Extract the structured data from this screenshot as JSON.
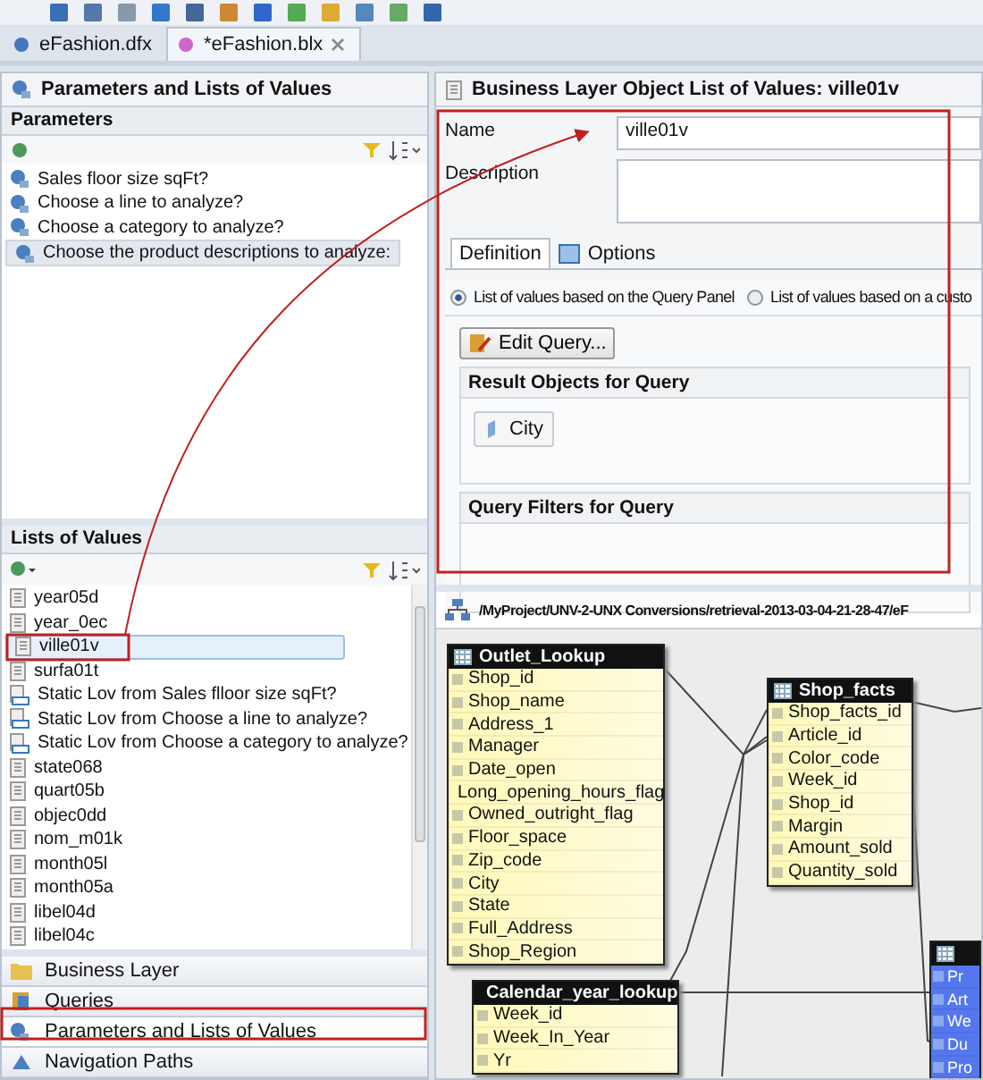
{
  "editor_tabs": [
    {
      "label": "eFashion.dfx",
      "selected": false
    },
    {
      "label": "*eFashion.blx",
      "selected": true
    }
  ],
  "left_panel": {
    "title": "Parameters and Lists of Values",
    "parameters": {
      "title": "Parameters",
      "items": [
        {
          "label": "Sales floor size sqFt?",
          "selected": false
        },
        {
          "label": "Choose a line to analyze?",
          "selected": false
        },
        {
          "label": "Choose a category to analyze?",
          "selected": false
        },
        {
          "label": "Choose the product descriptions to analyze:",
          "selected": true
        }
      ]
    },
    "lists_of_values": {
      "title": "Lists of Values",
      "items": [
        {
          "label": "year05d",
          "kind": "lov",
          "selected": false
        },
        {
          "label": "year_0ec",
          "kind": "lov",
          "selected": false
        },
        {
          "label": "ville01v",
          "kind": "lov",
          "selected": true
        },
        {
          "label": "surfa01t",
          "kind": "lov",
          "selected": false
        },
        {
          "label": "Static Lov from Sales flloor size sqFt?",
          "kind": "static",
          "selected": false
        },
        {
          "label": "Static Lov from Choose a line to analyze?",
          "kind": "static",
          "selected": false
        },
        {
          "label": "Static Lov from Choose a category to analyze?",
          "kind": "static",
          "selected": false
        },
        {
          "label": "state068",
          "kind": "lov",
          "selected": false
        },
        {
          "label": "quart05b",
          "kind": "lov",
          "selected": false
        },
        {
          "label": "objec0dd",
          "kind": "lov",
          "selected": false
        },
        {
          "label": "nom_m01k",
          "kind": "lov",
          "selected": false
        },
        {
          "label": "month05l",
          "kind": "lov",
          "selected": false
        },
        {
          "label": "month05a",
          "kind": "lov",
          "selected": false
        },
        {
          "label": "libel04d",
          "kind": "lov",
          "selected": false
        },
        {
          "label": "libel04c",
          "kind": "lov",
          "selected": false
        }
      ]
    }
  },
  "nav": [
    {
      "label": "Business Layer",
      "kind": "folder",
      "selected": false
    },
    {
      "label": "Queries",
      "kind": "queries",
      "selected": false
    },
    {
      "label": "Parameters and Lists of Values",
      "kind": "params",
      "selected": true
    },
    {
      "label": "Navigation Paths",
      "kind": "paths",
      "selected": false
    }
  ],
  "editor": {
    "title": "Business Layer Object List of Values: ville01v",
    "name_label": "Name",
    "name_value": "ville01v",
    "description_label": "Description",
    "tabs": [
      {
        "label": "Definition",
        "selected": true
      },
      {
        "label": "Options",
        "selected": false
      }
    ],
    "radios": [
      {
        "label": "List of values based on the Query Panel",
        "selected": true
      },
      {
        "label": "List of values based on a custo",
        "selected": false
      }
    ],
    "edit_query": "Edit Query...",
    "result_objects": {
      "title": "Result Objects for Query",
      "items": [
        "City"
      ]
    },
    "query_filters": {
      "title": "Query Filters for Query"
    }
  },
  "diagram": {
    "path": "/MyProject/UNV-2-UNX Conversions/retrieval-2013-03-04-21-28-47/eF",
    "tables": [
      {
        "name": "Outlet_Lookup",
        "kind": "yellow",
        "columns": [
          "Shop_id",
          "Shop_name",
          "Address_1",
          "Manager",
          "Date_open",
          "Long_opening_hours_flag",
          "Owned_outright_flag",
          "Floor_space",
          "Zip_code",
          "City",
          "State",
          "Full_Address",
          "Shop_Region"
        ]
      },
      {
        "name": "Shop_facts",
        "kind": "yellow",
        "columns": [
          "Shop_facts_id",
          "Article_id",
          "Color_code",
          "Week_id",
          "Shop_id",
          "Margin",
          "Amount_sold",
          "Quantity_sold"
        ]
      },
      {
        "name": "Calendar_year_lookup",
        "kind": "yellow",
        "columns": [
          "Week_id",
          "Week_In_Year",
          "Yr"
        ]
      },
      {
        "kind": "blue",
        "columns": [
          "Pr",
          "Art",
          "We",
          "Du",
          "Pro"
        ]
      }
    ]
  }
}
